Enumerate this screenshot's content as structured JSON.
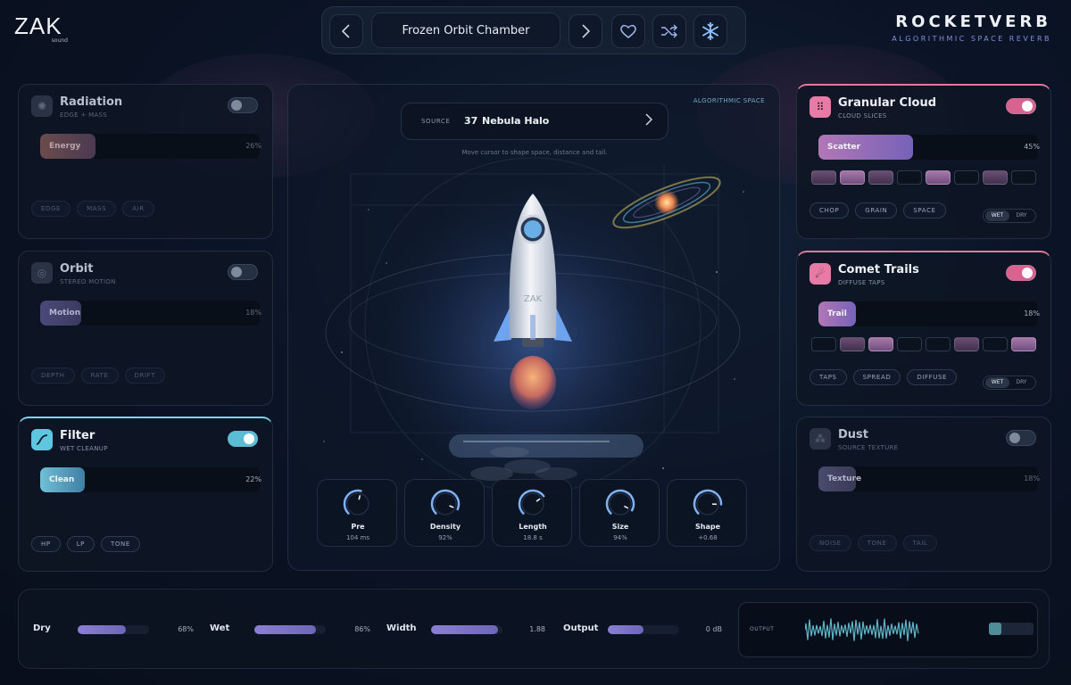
{
  "brand": {
    "logo": "ZAK",
    "logo_sub": "sound"
  },
  "preset": {
    "name": "Frozen Orbit Chamber"
  },
  "product": {
    "name": "ROCKETVERB",
    "tagline": "ALGORITHMIC SPACE REVERB"
  },
  "colors": {
    "accent_pink": "#e3789e",
    "accent_cyan": "#7ed3ea",
    "accent_purple": "#8a7fd6"
  },
  "modules_left": [
    {
      "title": "Radiation",
      "sub": "EDGE + MASS",
      "slider_label": "Energy",
      "value": "26%",
      "enabled": false,
      "chips": [
        "EDGE",
        "MASS",
        "AIR"
      ],
      "icon": "radiation-icon"
    },
    {
      "title": "Orbit",
      "sub": "STEREO MOTION",
      "slider_label": "Motion",
      "value": "18%",
      "enabled": false,
      "chips": [
        "DEPTH",
        "RATE",
        "DRIFT"
      ],
      "icon": "orbit-icon"
    },
    {
      "title": "Filter",
      "sub": "WET CLEANUP",
      "slider_label": "Clean",
      "value": "22%",
      "enabled": true,
      "chips": [
        "HP",
        "LP",
        "TONE"
      ],
      "icon": "filter-curve-icon"
    }
  ],
  "modules_right": [
    {
      "title": "Granular Cloud",
      "sub": "CLOUD SLICES",
      "slider_label": "Scatter",
      "value": "45%",
      "enabled": true,
      "chips": [
        "CHOP",
        "GRAIN",
        "SPACE"
      ],
      "wet": "WET",
      "dry": "DRY",
      "icon": "granular-icon"
    },
    {
      "title": "Comet Trails",
      "sub": "DIFFUSE TAPS",
      "slider_label": "Trail",
      "value": "18%",
      "enabled": true,
      "chips": [
        "TAPS",
        "SPREAD",
        "DIFFUSE"
      ],
      "wet": "WET",
      "dry": "DRY",
      "icon": "comet-icon"
    },
    {
      "title": "Dust",
      "sub": "SOURCE TEXTURE",
      "slider_label": "Texture",
      "value": "18%",
      "enabled": false,
      "chips": [
        "NOISE",
        "TONE",
        "TAIL"
      ],
      "icon": "dust-icon"
    }
  ],
  "stage": {
    "label": "ALGORITHMIC SPACE",
    "source_label": "SOURCE",
    "source_number": "37",
    "source_name": "Nebula Halo",
    "hint": "Move cursor to shape space, distance and tail.",
    "rocket_text": "ZAK"
  },
  "knobs": [
    {
      "name": "Pre",
      "value": "104 ms",
      "level": 0.55
    },
    {
      "name": "Density",
      "value": "92%",
      "level": 0.92
    },
    {
      "name": "Length",
      "value": "18.8 s",
      "level": 0.7
    },
    {
      "name": "Size",
      "value": "94%",
      "level": 0.94
    },
    {
      "name": "Shape",
      "value": "+0.68",
      "level": 0.84
    }
  ],
  "mix": [
    {
      "label": "Dry",
      "value": "68%",
      "level": 0.68
    },
    {
      "label": "Wet",
      "value": "86%",
      "level": 0.86
    },
    {
      "label": "Width",
      "value": "1.88",
      "level": 0.94
    },
    {
      "label": "Output",
      "value": "0 dB",
      "level": 0.5
    }
  ],
  "output": {
    "label": "OUTPUT"
  }
}
